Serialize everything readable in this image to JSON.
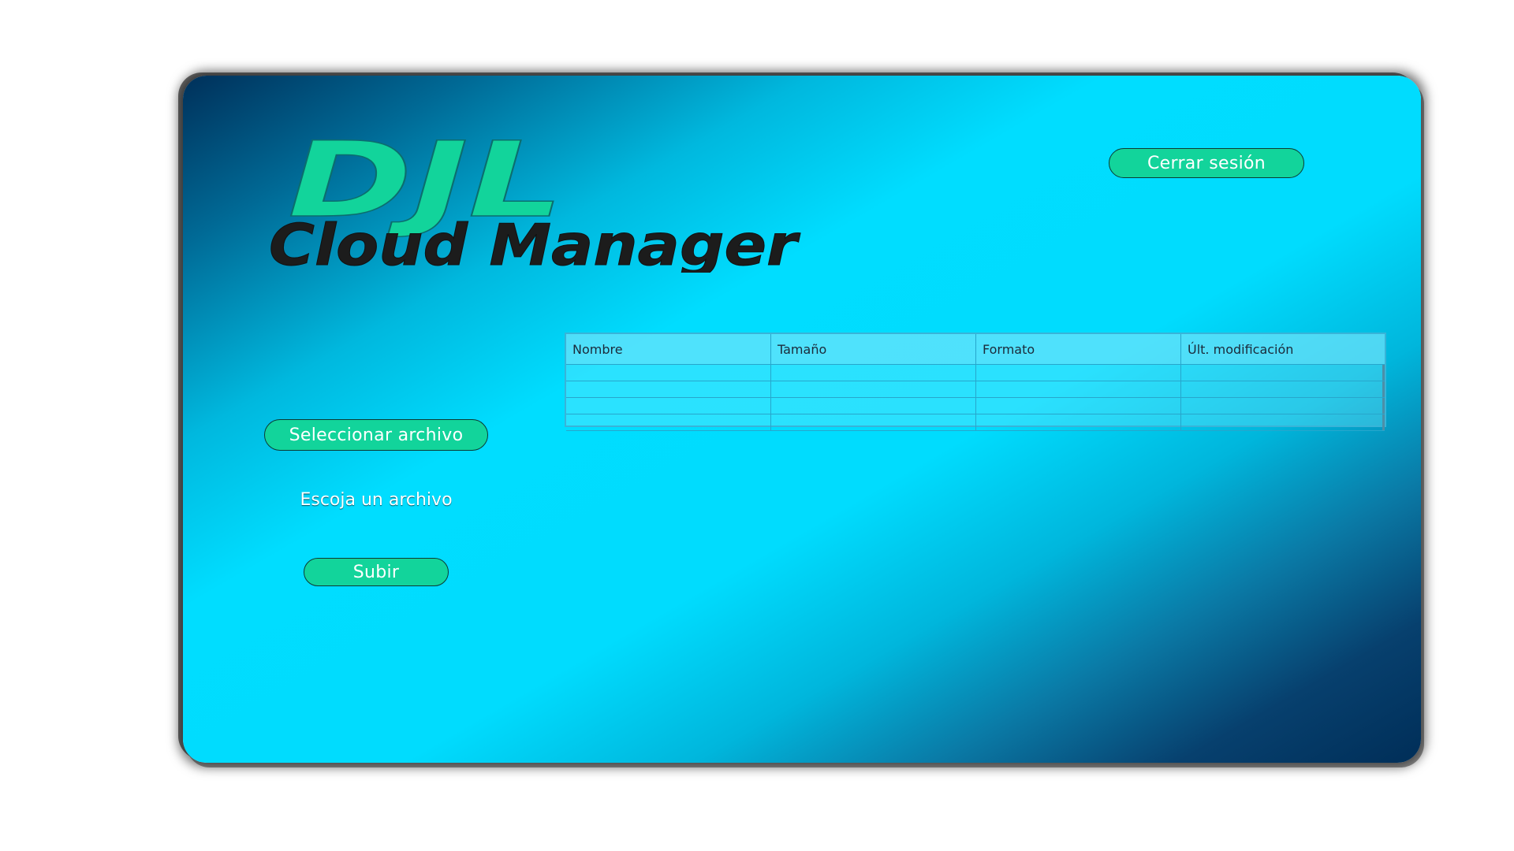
{
  "app": {
    "logo_text_top": "DJL",
    "logo_text_bottom": "Cloud Manager"
  },
  "header": {
    "logout_label": "Cerrar sesión"
  },
  "upload_panel": {
    "select_label": "Seleccionar archivo",
    "status_text": "Escoja un archivo",
    "upload_label": "Subir"
  },
  "file_table": {
    "columns": [
      "Nombre",
      "Tamaño",
      "Formato",
      "Últ. modificación"
    ],
    "rows": [
      [
        "",
        "",
        "",
        ""
      ],
      [
        "",
        "",
        "",
        ""
      ],
      [
        "",
        "",
        "",
        ""
      ],
      [
        "",
        "",
        "",
        ""
      ]
    ]
  },
  "colors": {
    "accent_green": "#12d49b",
    "background_cyan": "#00ddff",
    "background_navy": "#002e58"
  }
}
